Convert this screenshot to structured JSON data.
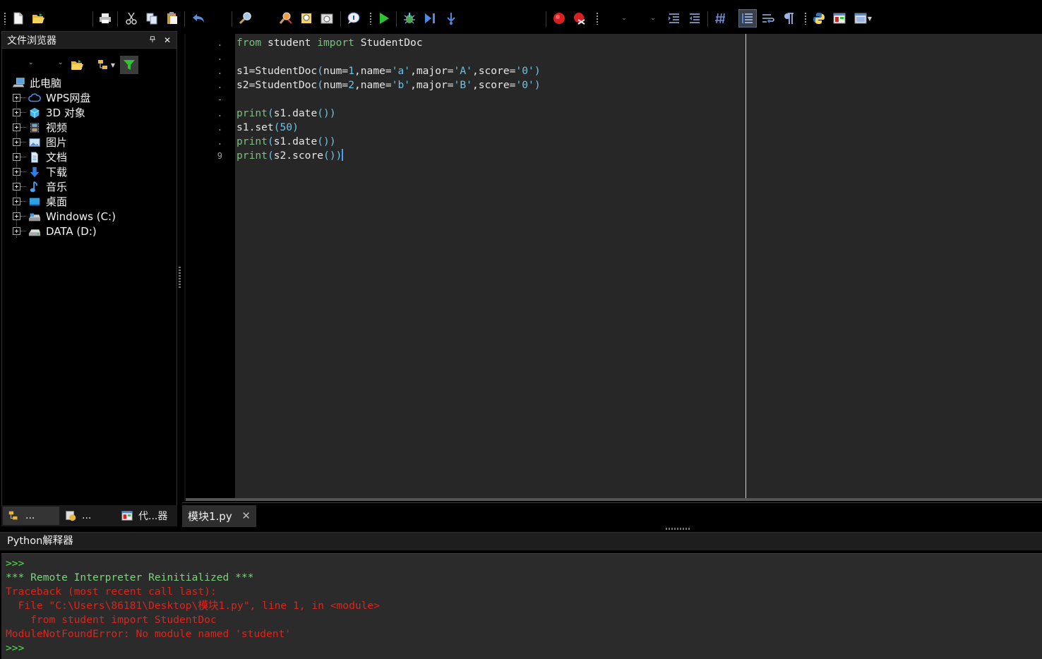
{
  "colors": {
    "keyword": "#78c07c",
    "literal": "#6ec3e6",
    "error": "#e2231a",
    "prompt": "#4ce04c",
    "caret": "#46a0ff"
  },
  "file_browser": {
    "title": "文件浏览器",
    "pin_glyph": "⬝",
    "close_glyph": "✕",
    "tree": [
      {
        "label": "此电脑",
        "icon": "computer-icon",
        "expandable": false
      },
      {
        "label": "WPS网盘",
        "icon": "cloud-icon",
        "expandable": true
      },
      {
        "label": "3D 对象",
        "icon": "cube-icon",
        "expandable": true
      },
      {
        "label": "视频",
        "icon": "video-icon",
        "expandable": true
      },
      {
        "label": "图片",
        "icon": "picture-icon",
        "expandable": true
      },
      {
        "label": "文档",
        "icon": "document-icon",
        "expandable": true
      },
      {
        "label": "下载",
        "icon": "download-icon",
        "expandable": true
      },
      {
        "label": "音乐",
        "icon": "music-icon",
        "expandable": true
      },
      {
        "label": "桌面",
        "icon": "desktop-icon",
        "expandable": true
      },
      {
        "label": "Windows (C:)",
        "icon": "drive-c-icon",
        "expandable": true
      },
      {
        "label": "DATA (D:)",
        "icon": "drive-d-icon",
        "expandable": true
      }
    ]
  },
  "left_tabs": [
    {
      "label": "...",
      "icon": "file-browser-tab-icon",
      "active": true
    },
    {
      "label": "...",
      "icon": "project-tab-icon",
      "active": false
    },
    {
      "label": "代...器",
      "icon": "code-browser-tab-icon",
      "active": false
    }
  ],
  "editor": {
    "gutter": [
      ".",
      ".",
      "",
      ".",
      ".",
      "-",
      ".",
      ".",
      ".",
      "9"
    ],
    "lines": [
      [
        [
          "kw",
          "from"
        ],
        [
          "op",
          " student "
        ],
        [
          "kw",
          "import"
        ],
        [
          "op",
          " StudentDoc"
        ]
      ],
      [],
      [
        [
          "op",
          "s1=StudentDoc"
        ],
        [
          "paren",
          "("
        ],
        [
          "op",
          "num="
        ],
        [
          "num",
          "1"
        ],
        [
          "op",
          ",name="
        ],
        [
          "str",
          "'a'"
        ],
        [
          "op",
          ",major="
        ],
        [
          "str",
          "'A'"
        ],
        [
          "op",
          ",score="
        ],
        [
          "str",
          "'0'"
        ],
        [
          "paren",
          ")"
        ]
      ],
      [
        [
          "op",
          "s2=StudentDoc"
        ],
        [
          "paren",
          "("
        ],
        [
          "op",
          "num="
        ],
        [
          "num",
          "2"
        ],
        [
          "op",
          ",name="
        ],
        [
          "str",
          "'b'"
        ],
        [
          "op",
          ",major="
        ],
        [
          "str",
          "'B'"
        ],
        [
          "op",
          ",score="
        ],
        [
          "str",
          "'0'"
        ],
        [
          "paren",
          ")"
        ]
      ],
      [],
      [
        [
          "kw",
          "print"
        ],
        [
          "paren",
          "("
        ],
        [
          "op",
          "s1.date"
        ],
        [
          "paren",
          "())"
        ]
      ],
      [
        [
          "op",
          "s1.set"
        ],
        [
          "paren",
          "("
        ],
        [
          "num",
          "50"
        ],
        [
          "paren",
          ")"
        ]
      ],
      [
        [
          "kw",
          "print"
        ],
        [
          "paren",
          "("
        ],
        [
          "op",
          "s1.date"
        ],
        [
          "paren",
          "())"
        ]
      ],
      [
        [
          "kw",
          "print"
        ],
        [
          "paren",
          "("
        ],
        [
          "op",
          "s2.score"
        ],
        [
          "paren",
          "())"
        ],
        [
          "caret",
          ""
        ]
      ]
    ]
  },
  "editor_tabs": [
    {
      "label": "模块1.py",
      "close": "✕"
    }
  ],
  "interpreter": {
    "title": "Python解释器",
    "output": [
      {
        "type": "prompt",
        "text": ">>>"
      },
      {
        "type": "info",
        "text": "*** Remote Interpreter Reinitialized ***"
      },
      {
        "type": "error",
        "text": "Traceback (most recent call last):"
      },
      {
        "type": "error",
        "text": "  File \"C:\\Users\\86181\\Desktop\\模块1.py\", line 1, in <module>"
      },
      {
        "type": "error",
        "text": "    from student import StudentDoc"
      },
      {
        "type": "error",
        "text": "ModuleNotFoundError: No module named 'student'"
      },
      {
        "type": "prompt",
        "text": ">>>"
      }
    ]
  }
}
